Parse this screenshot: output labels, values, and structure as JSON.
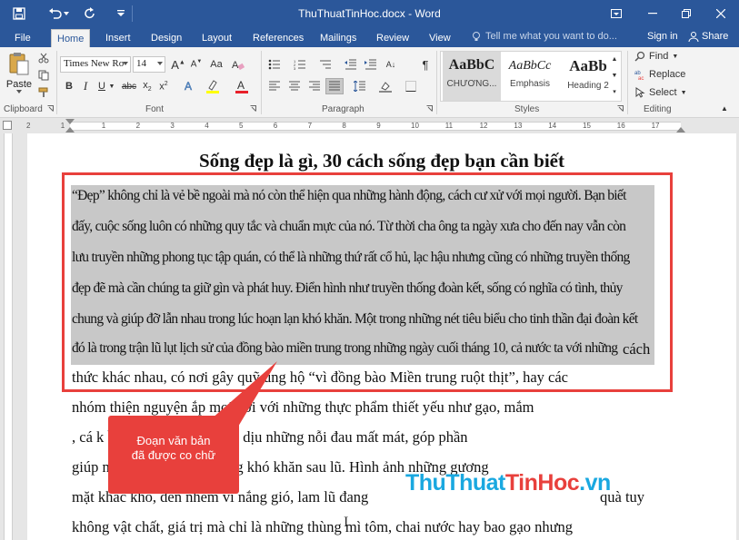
{
  "window": {
    "title": "ThuThuatTinHoc.docx - Word"
  },
  "tabs": [
    "File",
    "Home",
    "Insert",
    "Design",
    "Layout",
    "References",
    "Mailings",
    "Review",
    "View"
  ],
  "tellme_placeholder": "Tell me what you want to do...",
  "signin_label": "Sign in",
  "share_label": "Share",
  "clipboard": {
    "paste_label": "Paste",
    "group_label": "Clipboard"
  },
  "font": {
    "name": "Times New Ro",
    "size": "14",
    "group_label": "Font"
  },
  "paragraph": {
    "group_label": "Paragraph"
  },
  "styles": {
    "group_label": "Styles",
    "items": [
      {
        "preview": "AaBbC",
        "name": "CHƯƠNG..."
      },
      {
        "preview": "AaBbCc",
        "name": "Emphasis"
      },
      {
        "preview": "AaBb",
        "name": "Heading 2"
      }
    ]
  },
  "editing": {
    "group_label": "Editing",
    "find": "Find",
    "replace": "Replace",
    "select": "Select"
  },
  "ruler_numbers": [
    "2",
    "1",
    "1",
    "2",
    "3",
    "4",
    "5",
    "6",
    "7",
    "8",
    "9",
    "10",
    "11",
    "12",
    "13",
    "14",
    "15",
    "16",
    "17"
  ],
  "document": {
    "title": "Sống đẹp là gì, 30 cách sống đẹp bạn cần biết",
    "lines": [
      " “Đẹp” không chỉ là vẻ bề ngoài mà nó còn thể hiện qua những hành động, cách cư xử với mọi người. Bạn biết",
      "đấy, cuộc sống luôn có những quy tắc và chuẩn mực của nó. Từ thời cha ông ta ngày xưa cho đến nay vẫn còn",
      "lưu truyền những phong tục tập quán, có thể là những thứ rất cổ hủ, lạc hậu nhưng cũng có những truyền thống",
      "đẹp đẽ mà cần chúng ta giữ gìn và phát huy. Điển hình như truyền thống đoàn kết, sống có nghĩa có tình, thủy",
      "chung và giúp đỡ lẫn nhau trong lúc hoạn lạn khó khăn. Một trong những nét tiêu biểu cho tinh thần đại đoàn kết",
      "đó là trong trận lũ lụt lịch sử của đồng bào miền trung trong những ngày cuối tháng 10, cả nước ta với những",
      "thức khác nhau, có nơi gây quỹ ủng hộ “vì đồng bào Miền trung ruột thịt”, hay các",
      "nhóm thiện nguyện   ắp mọi nơi với  những thực phẩm thiết yếu như gạo, mắm",
      ", cá k          ề chung tay nhằm xoa dịu những nỗi đau mất mát, góp phần",
      "giúp n          ương vượt qua những khó khăn sau lũ. Hình ảnh những gương",
      "mặt khắc khổ, đen nhẻm vì nắng gió, lam lũ đang",
      "không vật chất, giá trị mà chỉ là những thùng mì tôm, chai nước hay bao gạo nhưng"
    ],
    "line6_tail": "cách",
    "line11_tail": "quà tuy"
  },
  "annotation": {
    "callout_line1": "Đoạn văn bản",
    "callout_line2": "đã được co chữ"
  },
  "watermark": {
    "part1": "ThuThuat",
    "part2": "TinHoc",
    "part3": ".vn"
  }
}
